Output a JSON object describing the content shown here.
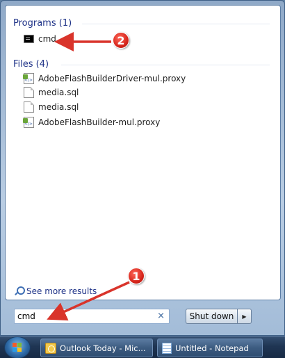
{
  "start_menu": {
    "programs_header": "Programs (1)",
    "programs": [
      {
        "label": "cmd",
        "icon": "cmd-icon"
      }
    ],
    "files_header": "Files (4)",
    "files": [
      {
        "label": "AdobeFlashBuilderDriver-mul.proxy",
        "icon": "xml-file-icon"
      },
      {
        "label": "media.sql",
        "icon": "document-icon"
      },
      {
        "label": "media.sql",
        "icon": "document-icon"
      },
      {
        "label": "AdobeFlashBuilder-mul.proxy",
        "icon": "xml-file-icon"
      }
    ],
    "see_more": "See more results",
    "search": {
      "value": "cmd",
      "clear_glyph": "×"
    },
    "shutdown_label": "Shut down",
    "shutdown_arrow": "▶"
  },
  "taskbar": {
    "items": [
      {
        "label": "Outlook Today - Mic...",
        "icon": "outlook-icon"
      },
      {
        "label": "Untitled - Notepad",
        "icon": "notepad-icon"
      }
    ]
  },
  "annotations": {
    "badge_1": "1",
    "badge_2": "2",
    "arrow_color": "#d9342b"
  }
}
